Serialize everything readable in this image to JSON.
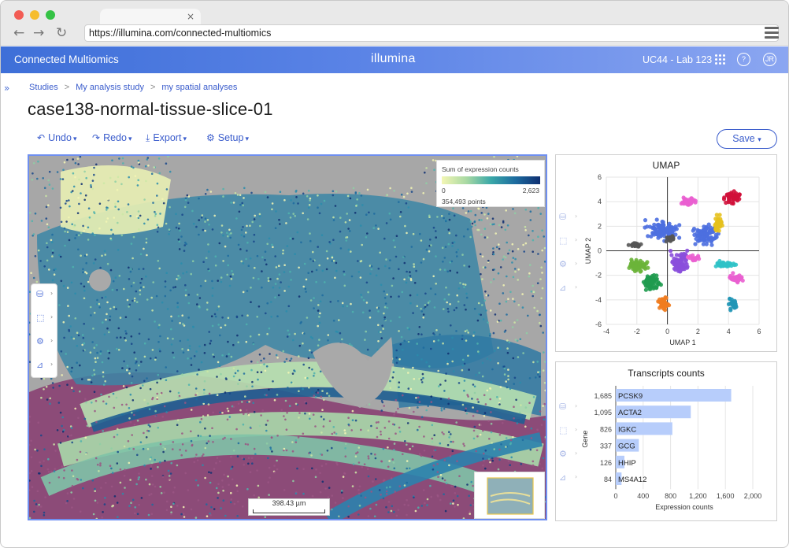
{
  "browser": {
    "url": "https://illumina.com/connected-multiomics",
    "tab_close": "×",
    "back": "←",
    "forward": "→",
    "reload": "↻"
  },
  "header": {
    "app_name": "Connected Multiomics",
    "logo_text": "illumina",
    "lab": "UC44 - Lab 123",
    "help": "?",
    "user_initials": "JR"
  },
  "breadcrumb": [
    "Studies",
    "My analysis study",
    "my spatial analyses"
  ],
  "breadcrumb_sep": ">",
  "expand_icon": "»",
  "page_title": "case138-normal-tissue-slice-01",
  "toolbar": {
    "undo": "Undo",
    "redo": "Redo",
    "export": "Export",
    "setup": "Setup",
    "save": "Save"
  },
  "spatial": {
    "legend_title": "Sum of expression counts",
    "legend_min": "0",
    "legend_max": "2,623",
    "legend_points": "354,493 points",
    "scale_label": "398.43 µm",
    "colors": {
      "background": "#a9a9a9",
      "low": "#f3f6b4",
      "mid": "#3aa8a8",
      "high": "#0f2f71",
      "magenta": "#8c4b78"
    }
  },
  "umap": {
    "title": "UMAP",
    "chart_data": {
      "type": "scatter",
      "title": "UMAP",
      "xlabel": "UMAP 1",
      "ylabel": "UMAP 2",
      "xlim": [
        -4,
        6
      ],
      "ylim": [
        -6,
        6
      ],
      "xticks": [
        -4,
        -2,
        0,
        2,
        4,
        6
      ],
      "yticks": [
        -6,
        -4,
        -2,
        0,
        2,
        4,
        6
      ],
      "clusters": [
        {
          "color": "#4d6fe0",
          "cx": -0.3,
          "cy": 1.7,
          "rx": 1.4,
          "ry": 1.0,
          "n": 120
        },
        {
          "color": "#4d6fe0",
          "cx": 2.6,
          "cy": 1.4,
          "rx": 1.2,
          "ry": 1.1,
          "n": 90
        },
        {
          "color": "#8a4fdc",
          "cx": 0.8,
          "cy": -1.0,
          "rx": 0.7,
          "ry": 1.3,
          "n": 80
        },
        {
          "color": "#6bb43a",
          "cx": -2.0,
          "cy": -1.2,
          "rx": 0.9,
          "ry": 0.6,
          "n": 70
        },
        {
          "color": "#1f9b4f",
          "cx": -1.0,
          "cy": -2.6,
          "rx": 0.7,
          "ry": 0.8,
          "n": 70
        },
        {
          "color": "#555555",
          "cx": -2.1,
          "cy": 0.5,
          "rx": 0.5,
          "ry": 0.3,
          "n": 25
        },
        {
          "color": "#555555",
          "cx": 0.2,
          "cy": 1.0,
          "rx": 0.4,
          "ry": 0.3,
          "n": 20
        },
        {
          "color": "#ea5fd0",
          "cx": 1.3,
          "cy": 4.0,
          "rx": 0.7,
          "ry": 0.5,
          "n": 40
        },
        {
          "color": "#d0103a",
          "cx": 4.3,
          "cy": 4.4,
          "rx": 0.8,
          "ry": 0.8,
          "n": 45
        },
        {
          "color": "#e6c11d",
          "cx": 3.3,
          "cy": 2.3,
          "rx": 0.4,
          "ry": 0.9,
          "n": 35
        },
        {
          "color": "#2fc2c6",
          "cx": 3.6,
          "cy": -1.1,
          "rx": 1.0,
          "ry": 0.3,
          "n": 45
        },
        {
          "color": "#ea5fd0",
          "cx": 4.5,
          "cy": -2.2,
          "rx": 0.7,
          "ry": 0.5,
          "n": 35
        },
        {
          "color": "#ea5fd0",
          "cx": 1.8,
          "cy": -0.6,
          "rx": 0.5,
          "ry": 0.4,
          "n": 20
        },
        {
          "color": "#2196b6",
          "cx": 4.3,
          "cy": -4.3,
          "rx": 0.4,
          "ry": 0.6,
          "n": 30
        },
        {
          "color": "#f07c1f",
          "cx": -0.3,
          "cy": -4.3,
          "rx": 0.5,
          "ry": 0.8,
          "n": 35
        }
      ]
    }
  },
  "transcripts": {
    "title": "Transcripts counts",
    "chart_data": {
      "type": "bar",
      "orientation": "horizontal",
      "title": "Transcripts counts",
      "xlabel": "Expression counts",
      "ylabel": "Gene",
      "categories": [
        "PCSK9",
        "ACTA2",
        "IGKC",
        "GCG",
        "HHIP",
        "MS4A12"
      ],
      "values": [
        1685,
        1095,
        826,
        337,
        126,
        84
      ],
      "value_labels": [
        "1,685",
        "1,095",
        "826",
        "337",
        "126",
        "84"
      ],
      "xlim": [
        0,
        2000
      ],
      "xticks": [
        "0",
        "400",
        "800",
        "1,200",
        "1,600",
        "2,000"
      ],
      "bar_color": "#b7cdfb"
    }
  }
}
